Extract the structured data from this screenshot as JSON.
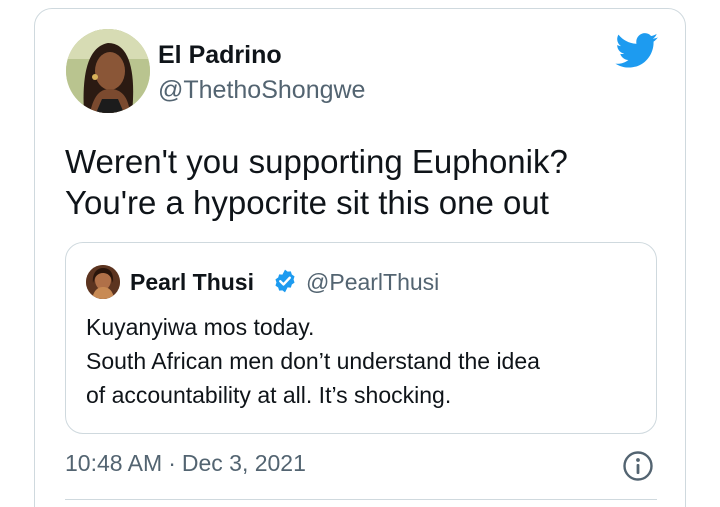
{
  "author": {
    "name": "El Padrino",
    "handle": "@ThethoShongwe"
  },
  "tweet": {
    "lines": [
      "Weren't you supporting Euphonik?",
      "You're a hypocrite sit this one out"
    ]
  },
  "quoted": {
    "name": "Pearl Thusi",
    "handle": "@PearlThusi",
    "verified": true,
    "lines": [
      "Kuyanyiwa mos today.",
      "South African men don’t understand the idea",
      "of accountability at all. It’s shocking."
    ]
  },
  "meta": {
    "time": "10:48 AM",
    "separator": "·",
    "date": "Dec 3, 2021"
  },
  "icons": {
    "brand": "twitter-bird-icon",
    "badge": "verified-badge-icon",
    "info": "info-icon"
  },
  "colors": {
    "brand": "#1d9bf0",
    "text": "#0f1419",
    "secondary": "#536471",
    "border": "#cfd9de"
  }
}
